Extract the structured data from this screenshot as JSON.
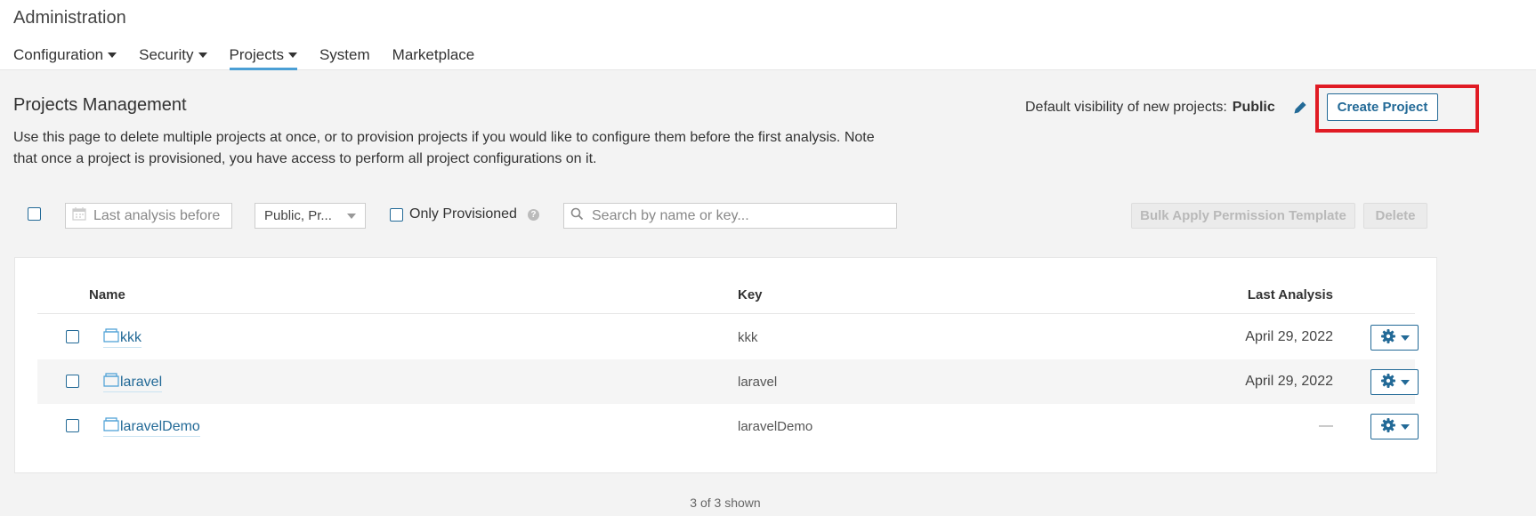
{
  "header": {
    "title": "Administration",
    "nav": [
      {
        "label": "Configuration",
        "dropdown": true
      },
      {
        "label": "Security",
        "dropdown": true
      },
      {
        "label": "Projects",
        "dropdown": true,
        "active": true
      },
      {
        "label": "System",
        "dropdown": false
      },
      {
        "label": "Marketplace",
        "dropdown": false
      }
    ]
  },
  "page": {
    "title": "Projects Management",
    "description": "Use this page to delete multiple projects at once, or to provision projects if you would like to configure them before the first analysis. Note that once a project is provisioned, you have access to perform all project configurations on it.",
    "visibility_label": "Default visibility of new projects:",
    "visibility_value": "Public",
    "create_button": "Create Project"
  },
  "toolbar": {
    "date_placeholder": "Last analysis before",
    "visibility_select": "Public, Pr...",
    "only_provisioned": "Only Provisioned",
    "search_placeholder": "Search by name or key...",
    "bulk_button": "Bulk Apply Permission Template",
    "delete_button": "Delete"
  },
  "table": {
    "columns": {
      "name": "Name",
      "key": "Key",
      "last_analysis": "Last Analysis"
    },
    "rows": [
      {
        "name": "kkk",
        "key": "kkk",
        "last_analysis": "April 29, 2022"
      },
      {
        "name": "laravel",
        "key": "laravel",
        "last_analysis": "April 29, 2022"
      },
      {
        "name": "laravelDemo",
        "key": "laravelDemo",
        "last_analysis": "—"
      }
    ],
    "shown": "3 of 3 shown"
  },
  "colors": {
    "accent": "#236a97",
    "highlight": "#e01b24",
    "tab_underline": "#4b9fd5"
  },
  "icons": [
    "calendar-icon",
    "search-icon",
    "pencil-icon",
    "help-icon",
    "gear-icon",
    "project-icon"
  ]
}
